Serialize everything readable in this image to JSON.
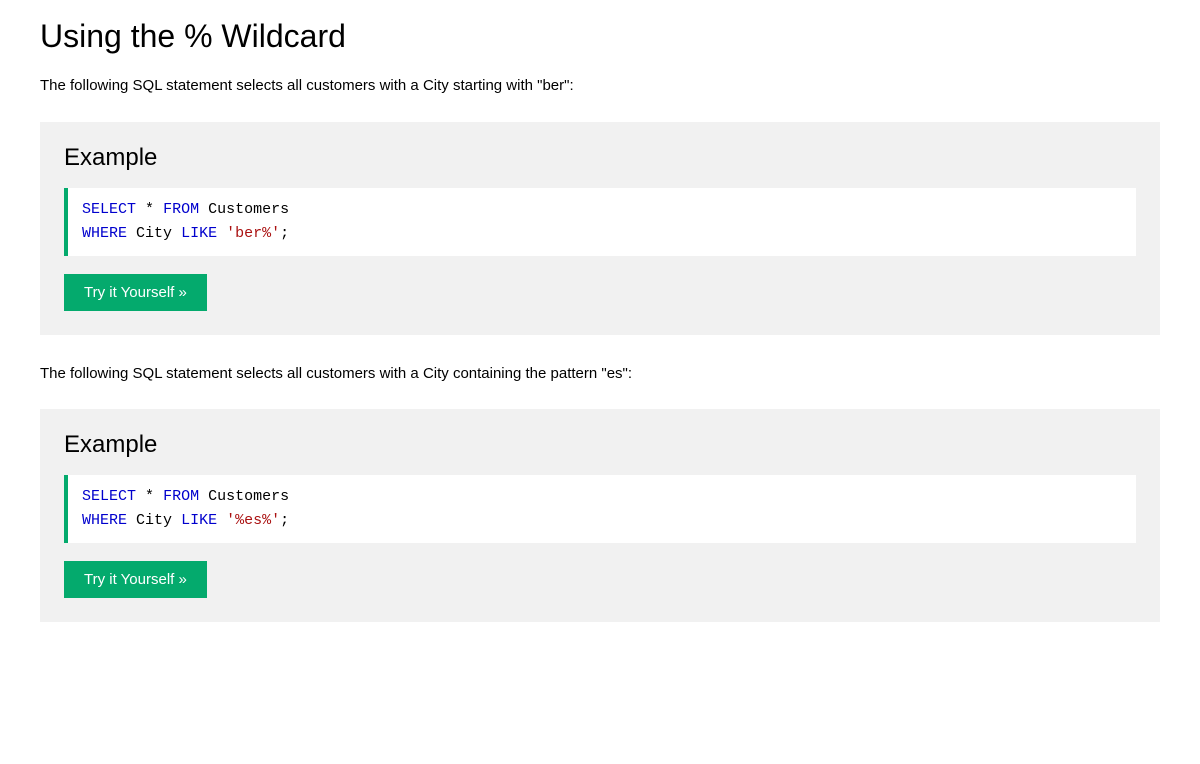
{
  "title": "Using the % Wildcard",
  "intro1": "The following SQL statement selects all customers with a City starting with \"ber\":",
  "intro2": "The following SQL statement selects all customers with a City containing the pattern \"es\":",
  "example_heading": "Example",
  "try_button_label": "Try it Yourself »",
  "sql": {
    "select": "SELECT",
    "star": "*",
    "from": "FROM",
    "customers": "Customers",
    "where": "WHERE",
    "city": "City",
    "like": "LIKE",
    "string1": "'ber%'",
    "string2": "'%es%'",
    "semicolon": ";"
  }
}
